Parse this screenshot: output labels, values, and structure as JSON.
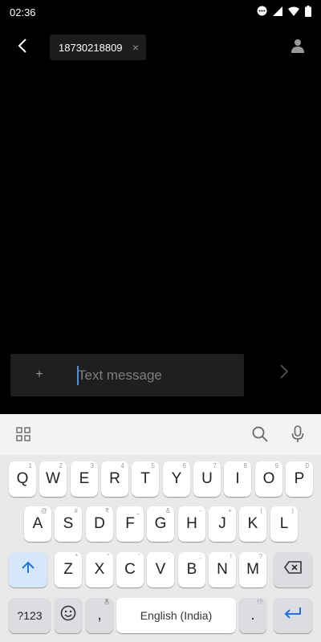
{
  "status_bar": {
    "time": "02:36",
    "icons": [
      "more-dots-icon",
      "signal-icon",
      "wifi-icon",
      "battery-icon"
    ]
  },
  "header": {
    "recipient": "18730218809",
    "icons": [
      "back-arrow-icon",
      "close-icon",
      "contact-person-icon"
    ]
  },
  "compose": {
    "placeholder": "Text message",
    "attach_label": "+",
    "icons": [
      "plus-icon",
      "send-chevron-icon"
    ]
  },
  "keyboard": {
    "toolbar_icons": [
      "grid-menu-icon",
      "search-icon",
      "mic-icon"
    ],
    "row1": [
      {
        "label": "Q",
        "hint": "1"
      },
      {
        "label": "W",
        "hint": "2"
      },
      {
        "label": "E",
        "hint": "3"
      },
      {
        "label": "R",
        "hint": "4"
      },
      {
        "label": "T",
        "hint": "5"
      },
      {
        "label": "Y",
        "hint": "6"
      },
      {
        "label": "U",
        "hint": "7"
      },
      {
        "label": "I",
        "hint": "8"
      },
      {
        "label": "O",
        "hint": "9"
      },
      {
        "label": "P",
        "hint": "0"
      }
    ],
    "row2": [
      {
        "label": "A",
        "hint": "@"
      },
      {
        "label": "S",
        "hint": "#"
      },
      {
        "label": "D",
        "hint": "₹"
      },
      {
        "label": "F",
        "hint": "_"
      },
      {
        "label": "G",
        "hint": "&"
      },
      {
        "label": "H",
        "hint": "-"
      },
      {
        "label": "J",
        "hint": "+"
      },
      {
        "label": "K",
        "hint": "("
      },
      {
        "label": "L",
        "hint": ")"
      }
    ],
    "row3": [
      {
        "label": "Z",
        "hint": "*"
      },
      {
        "label": "X",
        "hint": "\""
      },
      {
        "label": "C",
        "hint": "'"
      },
      {
        "label": "V",
        "hint": ":"
      },
      {
        "label": "B",
        "hint": ";"
      },
      {
        "label": "N",
        "hint": "!"
      },
      {
        "label": "M",
        "hint": "?"
      }
    ],
    "symbols_key": "?123",
    "comma_key": ",",
    "space_label": "English (India)",
    "period_key": ".",
    "period_hint": "!?",
    "func_icons": [
      "shift-arrow-icon",
      "backspace-icon",
      "emoji-icon",
      "enter-icon"
    ],
    "accent_color": "#1a73e8"
  }
}
